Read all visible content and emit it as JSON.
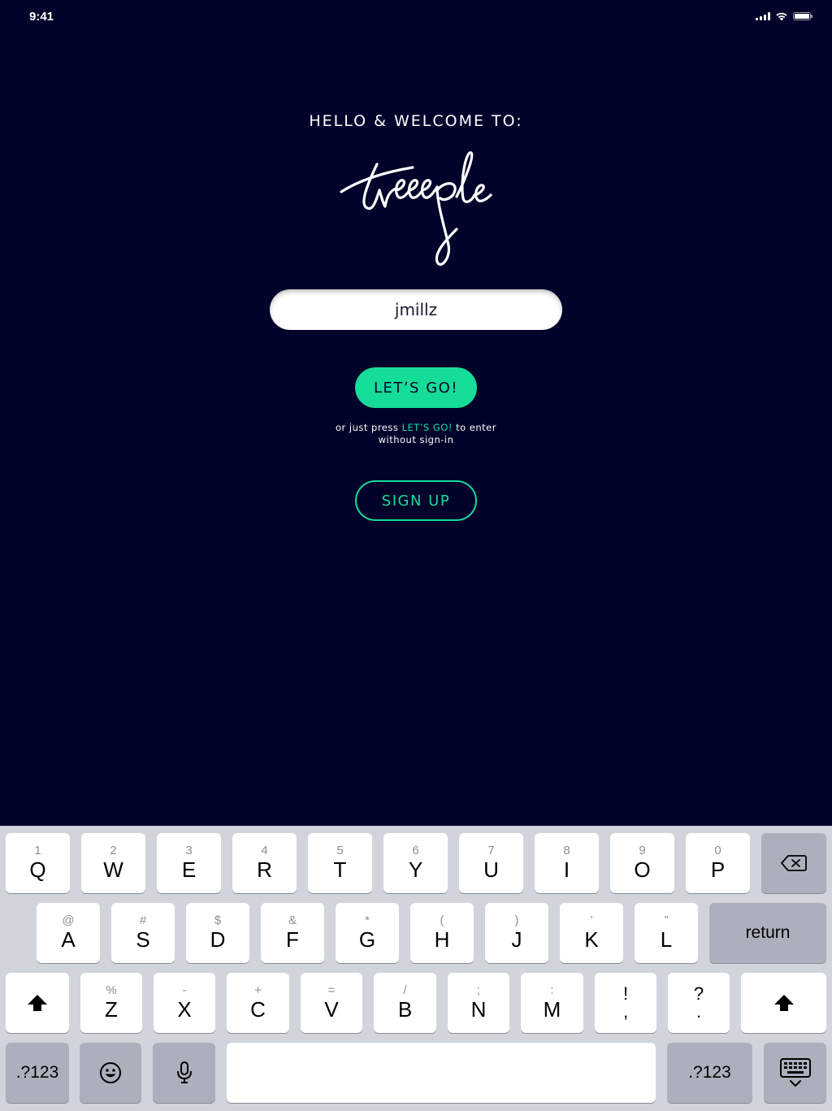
{
  "status_bar": {
    "time": "9:41"
  },
  "welcome": {
    "heading": "HELLO & WELCOME TO:",
    "logo_text": "treeple"
  },
  "login": {
    "username_value": "jmillz",
    "lets_go_label": "LET’S GO!",
    "hint_prefix": "or just press ",
    "hint_highlight": "LET’S GO!",
    "hint_suffix": " to enter",
    "hint_line2": "without sign-in",
    "sign_up_label": "SIGN UP"
  },
  "colors": {
    "background": "#02032a",
    "accent": "#16dc9a",
    "text": "#ffffff"
  },
  "keyboard": {
    "row1": [
      {
        "sub": "1",
        "main": "Q"
      },
      {
        "sub": "2",
        "main": "W"
      },
      {
        "sub": "3",
        "main": "E"
      },
      {
        "sub": "4",
        "main": "R"
      },
      {
        "sub": "5",
        "main": "T"
      },
      {
        "sub": "6",
        "main": "Y"
      },
      {
        "sub": "7",
        "main": "U"
      },
      {
        "sub": "8",
        "main": "I"
      },
      {
        "sub": "9",
        "main": "O"
      },
      {
        "sub": "0",
        "main": "P"
      }
    ],
    "row2": [
      {
        "sub": "@",
        "main": "A"
      },
      {
        "sub": "#",
        "main": "S"
      },
      {
        "sub": "$",
        "main": "D"
      },
      {
        "sub": "&",
        "main": "F"
      },
      {
        "sub": "*",
        "main": "G"
      },
      {
        "sub": "(",
        "main": "H"
      },
      {
        "sub": ")",
        "main": "J"
      },
      {
        "sub": "’",
        "main": "K"
      },
      {
        "sub": "”",
        "main": "L"
      }
    ],
    "row3": [
      {
        "sub": "%",
        "main": "Z"
      },
      {
        "sub": "-",
        "main": "X"
      },
      {
        "sub": "+",
        "main": "C"
      },
      {
        "sub": "=",
        "main": "V"
      },
      {
        "sub": "/",
        "main": "B"
      },
      {
        "sub": ";",
        "main": "N"
      },
      {
        "sub": ":",
        "main": "M"
      },
      {
        "sub": "!",
        "main": ","
      },
      {
        "sub": "?",
        "main": "."
      }
    ],
    "return_label": "return",
    "numbers_label": ".?123",
    "icons": {
      "delete": "backspace-icon",
      "shift": "shift-icon",
      "emoji": "emoji-icon",
      "mic": "microphone-icon",
      "dismiss": "keyboard-dismiss-icon"
    }
  }
}
